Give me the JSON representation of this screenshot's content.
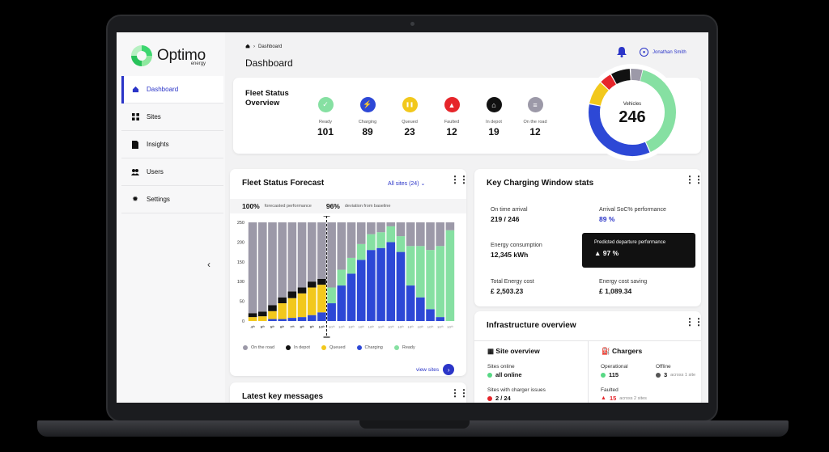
{
  "brand": {
    "name": "Optimo",
    "sub": "energy",
    "accent": "#2b35c8"
  },
  "breadcrumb": {
    "home_icon": "home-icon",
    "current": "Dashboard"
  },
  "header": {
    "title": "Dashboard",
    "user_name": "Jonathan Smith"
  },
  "sidebar": {
    "items": [
      {
        "label": "Dashboard",
        "icon": "home-icon"
      },
      {
        "label": "Sites",
        "icon": "grid-icon"
      },
      {
        "label": "Insights",
        "icon": "document-icon"
      },
      {
        "label": "Users",
        "icon": "users-icon"
      },
      {
        "label": "Settings",
        "icon": "gear-icon"
      }
    ]
  },
  "fleet_status": {
    "title": "Fleet Status Overview",
    "items": [
      {
        "label": "Ready",
        "value": "101",
        "color": "#86e0a2",
        "icon": "check-icon"
      },
      {
        "label": "Charging",
        "value": "89",
        "color": "#2d48d6",
        "icon": "bolt-icon"
      },
      {
        "label": "Queued",
        "value": "23",
        "color": "#f2c81c",
        "icon": "pause-icon"
      },
      {
        "label": "Faulted",
        "value": "12",
        "color": "#e6252a",
        "icon": "warning-icon"
      },
      {
        "label": "In depot",
        "value": "19",
        "color": "#111111",
        "icon": "depot-icon"
      },
      {
        "label": "On the road",
        "value": "12",
        "color": "#9c99a8",
        "icon": "road-icon"
      }
    ]
  },
  "vehicles": {
    "label": "Vehicles",
    "value": "246"
  },
  "forecast": {
    "title": "Fleet Status Forecast",
    "filter": "All sites",
    "filter_count": "(24)",
    "perf_value": "100%",
    "perf_label": "forecasted performance",
    "dev_value": "96%",
    "dev_label": "deviation from baseline",
    "legend": [
      {
        "label": "On the road",
        "color": "#9c99a8"
      },
      {
        "label": "In depot",
        "color": "#111111"
      },
      {
        "label": "Queued",
        "color": "#f2c81c"
      },
      {
        "label": "Charging",
        "color": "#2d48d6"
      },
      {
        "label": "Ready",
        "color": "#86e0a2"
      }
    ],
    "view_sites": "view sites"
  },
  "chart_data": {
    "type": "bar",
    "stacked": true,
    "categories": [
      "4ᵗʰ",
      "5ᵗʰ",
      "5ᵗʰ",
      "6ᵗʰ",
      "7ᵗʰ",
      "8ᵗʰ",
      "9ᵗʰ",
      "10ᵗʰ",
      "10ᵗʰ",
      "10ᵗʰ",
      "10ᵗʰ",
      "10ᵗʰ",
      "10ᵗʰ",
      "10ᵗʰ",
      "10ᵗʰ",
      "10ᵗʰ",
      "10ᵗʰ",
      "10ᵗʰ",
      "10ᵗʰ",
      "10ᵗʰ",
      "10ᵗʰ"
    ],
    "ylim": [
      0,
      250
    ],
    "yticks": [
      0,
      50,
      100,
      150,
      200,
      250
    ],
    "series": [
      {
        "name": "Charging",
        "color": "#2d48d6",
        "values": [
          0,
          0,
          5,
          5,
          8,
          10,
          15,
          22,
          45,
          90,
          120,
          155,
          180,
          185,
          200,
          175,
          90,
          60,
          30,
          10,
          0
        ]
      },
      {
        "name": "Ready",
        "color": "#86e0a2",
        "values": [
          0,
          0,
          0,
          0,
          0,
          0,
          0,
          0,
          40,
          40,
          40,
          40,
          40,
          40,
          40,
          40,
          100,
          130,
          150,
          180,
          230
        ]
      },
      {
        "name": "Queued",
        "color": "#f2c81c",
        "values": [
          10,
          12,
          20,
          40,
          50,
          60,
          70,
          70,
          0,
          0,
          0,
          0,
          0,
          0,
          0,
          0,
          0,
          0,
          0,
          0,
          0
        ]
      },
      {
        "name": "In depot",
        "color": "#111111",
        "values": [
          10,
          12,
          15,
          15,
          17,
          15,
          15,
          15,
          0,
          0,
          0,
          0,
          0,
          0,
          0,
          0,
          0,
          0,
          0,
          0,
          0
        ]
      },
      {
        "name": "On the road",
        "color": "#9c99a8",
        "values": [
          230,
          226,
          210,
          190,
          175,
          165,
          150,
          143,
          165,
          120,
          90,
          55,
          30,
          25,
          10,
          35,
          60,
          60,
          70,
          60,
          20
        ]
      }
    ]
  },
  "key_charging": {
    "title": "Key Charging Window stats",
    "items": [
      {
        "label": "On time arrival",
        "value": "219 / 246"
      },
      {
        "label": "Arrival SoC% performance",
        "value": "89 %"
      },
      {
        "label": "Energy consumption",
        "value": "12,345 kWh"
      },
      {
        "label": "Predicted departure performance",
        "value": "97 %"
      },
      {
        "label": "Total Energy cost",
        "value": "£ 2,503.23"
      },
      {
        "label": "Energy cost saving",
        "value": "£ 1,089.34"
      }
    ]
  },
  "infrastructure": {
    "title": "Infrastructure overview",
    "site_overview": "Site overview",
    "sites_online_label": "Sites online",
    "sites_online_value": "all online",
    "sites_issues_label": "Sites with charger issues",
    "sites_issues_value": "2 / 24",
    "chargers": "Chargers",
    "operational_label": "Operational",
    "operational_value": "115",
    "offline_label": "Offline",
    "offline_value": "3",
    "offline_note": "across 1 site",
    "faulted_label": "Faulted",
    "faulted_value": "15",
    "faulted_note": "across 2 sites"
  },
  "messages": {
    "title": "Latest key messages"
  }
}
